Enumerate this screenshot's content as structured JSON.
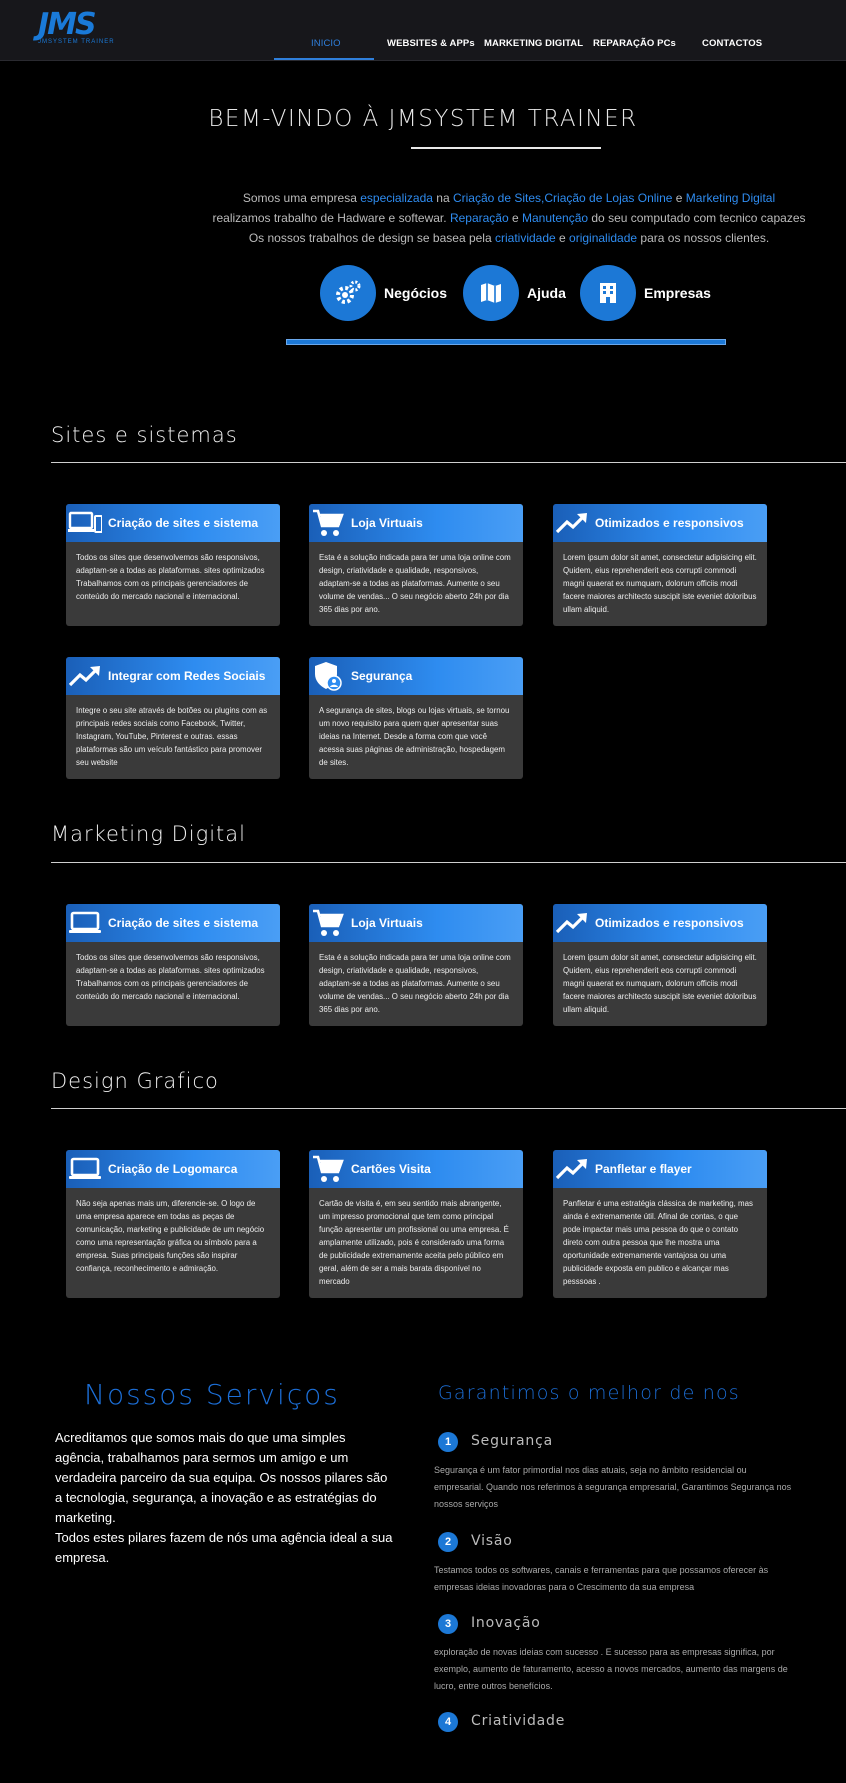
{
  "header": {
    "logo_text": "JMS",
    "logo_sub": "JMSYSTEM TRAINER",
    "nav": [
      {
        "label": "INICIO",
        "active": true
      },
      {
        "label": "WEBSITES & APPs"
      },
      {
        "label": "MARKETING DIGITAL"
      },
      {
        "label": "REPARAÇÃO PCs"
      },
      {
        "label": "CONTACTOS"
      }
    ]
  },
  "hero": {
    "title": "BEM-VINDO À JMSYSTEM TRAINER",
    "line1": {
      "a": "Somos uma empresa ",
      "b": "especializada",
      "c": " na ",
      "d": "Criação de Sites",
      "e": ",",
      "f": "Criação de Lojas Online",
      "g": " e ",
      "h": "Marketing Digital"
    },
    "line2": {
      "a": "realizamos trabalho de Hadware e softewar. ",
      "b": "Reparação",
      "c": " e ",
      "d": "Manutenção",
      "e": " do seu computado com tecnico capazes"
    },
    "line3": {
      "a": "Os nossos trabalhos de design se basea pela ",
      "b": "criatividade",
      "c": " e ",
      "d": "originalidade",
      "e": " para os nossos clientes."
    },
    "buttons": [
      {
        "label": "Negócios",
        "icon": "gears-icon"
      },
      {
        "label": "Ajuda",
        "icon": "map-icon"
      },
      {
        "label": "Empresas",
        "icon": "building-icon"
      }
    ]
  },
  "sections": {
    "sites": {
      "title": "Sites e sistemas",
      "cards": [
        {
          "title": "Criação de sites e sistema",
          "icon": "devices-icon",
          "text": "Todos os sites que desenvolvemos são responsivos, adaptam-se a todas as plataformas. sites optimizados Trabalhamos com os principais gerenciadores de conteúdo do mercado nacional e internacional."
        },
        {
          "title": "Loja Virtuais",
          "icon": "cart-icon",
          "text": "Esta é a solução indicada para ter uma loja online com design, criatividade e qualidade, responsivos, adaptam-se a todas as plataformas. Aumente o seu volume de vendas... O seu negócio aberto 24h por dia 365 dias por ano."
        },
        {
          "title": "Otimizados e responsivos",
          "icon": "trending-up-icon",
          "text": "Lorem ipsum dolor sit amet, consectetur adipisicing elit. Quidem, eius reprehenderit eos corrupti commodi magni quaerat ex numquam, dolorum officiis modi facere maiores architecto suscipit iste eveniet doloribus ullam aliquid."
        },
        {
          "title": "Integrar com Redes Sociais",
          "icon": "trending-up-icon",
          "text": "Integre o seu site através de botões ou plugins com as principais redes sociais como Facebook, Twitter, Instagram, YouTube, Pinterest e outras. essas plataformas são um veículo fantástico para promover seu website"
        },
        {
          "title": "Segurança",
          "icon": "shield-user-icon",
          "text": "A segurança de sites, blogs ou lojas virtuais, se tornou um novo requisito para quem quer apresentar suas ideias na Internet. Desde a forma com que você acessa suas páginas de administração, hospedagem de sites."
        }
      ]
    },
    "marketing": {
      "title": "Marketing Digital",
      "cards": [
        {
          "title": "Criação de sites e sistema",
          "icon": "laptop-icon",
          "text": "Todos os sites que desenvolvemos são responsivos, adaptam-se a todas as plataformas. sites optimizados Trabalhamos com os principais gerenciadores de conteúdo do mercado nacional e internacional."
        },
        {
          "title": "Loja Virtuais",
          "icon": "cart-icon",
          "text": "Esta é a solução indicada para ter uma loja online com design, criatividade e qualidade, responsivos, adaptam-se a todas as plataformas. Aumente o seu volume de vendas... O seu negócio aberto 24h por dia 365 dias por ano."
        },
        {
          "title": "Otimizados e responsivos",
          "icon": "trending-up-icon",
          "text": "Lorem ipsum dolor sit amet, consectetur adipisicing elit. Quidem, eius reprehenderit eos corrupti commodi magni quaerat ex numquam, dolorum officiis modi facere maiores architecto suscipit iste eveniet doloribus ullam aliquid."
        }
      ]
    },
    "design": {
      "title": "Design Grafico",
      "cards": [
        {
          "title": "Criação de Logomarca",
          "icon": "laptop-icon",
          "text": "Não seja apenas mais um, diferencie-se. O logo de uma empresa aparece em todas as peças de comunicação, marketing e publicidade de um negócio como uma representação gráfica ou símbolo para a empresa. Suas principais funções são inspirar confiança, reconhecimento e admiração."
        },
        {
          "title": "Cartões Visita",
          "icon": "cart-icon",
          "text": "Cartão de visita é, em seu sentido mais abrangente, um impresso promocional que tem como principal função apresentar um profissional ou uma empresa. É amplamente utilizado, pois é considerado uma forma de publicidade extremamente aceita pelo público em geral, além de ser a mais barata disponível no mercado"
        },
        {
          "title": "Panfletar e flayer",
          "icon": "trending-up-icon",
          "text": "Panfletar é uma estratégia clássica de marketing, mas ainda é extremamente útil. Afinal de contas, o que pode impactar mais uma pessoa do que o contato direto com outra pessoa que lhe mostra uma oportunidade extremamente vantajosa ou uma publicidade exposta em publico e alcançar mas pesssoas ."
        }
      ]
    }
  },
  "services": {
    "title": "Nossos Serviços",
    "text": "Acreditamos que somos mais do que uma simples agência, trabalhamos para sermos um amigo e um verdadeira parceiro da sua equipa. Os nossos pilares são a tecnologia, segurança, a inovação e as estratégias do marketing.",
    "text2": "Todos estes pilares fazem de nós uma agência ideal a sua empresa."
  },
  "guarantee": {
    "title": "Garantimos o melhor de nos",
    "items": [
      {
        "num": "1",
        "title": "Segurança",
        "text": "Segurança é um fator primordial nos dias atuais, seja no âmbito residencial ou empresarial. Quando nos referimos à segurança empresarial, Garantimos Segurança nos nossos serviços"
      },
      {
        "num": "2",
        "title": "Visão",
        "text": "Testamos todos os softwares, canais e ferramentas para que possamos oferecer às empresas ideias inovadoras para o Crescimento da sua empresa"
      },
      {
        "num": "3",
        "title": "Inovação",
        "text": "exploração de novas ideias com sucesso . E sucesso para as empresas significa, por exemplo, aumento de faturamento, acesso a novos mercados, aumento das margens de lucro, entre outros benefícios."
      },
      {
        "num": "4",
        "title": "Criatividade",
        "text": ""
      }
    ]
  }
}
